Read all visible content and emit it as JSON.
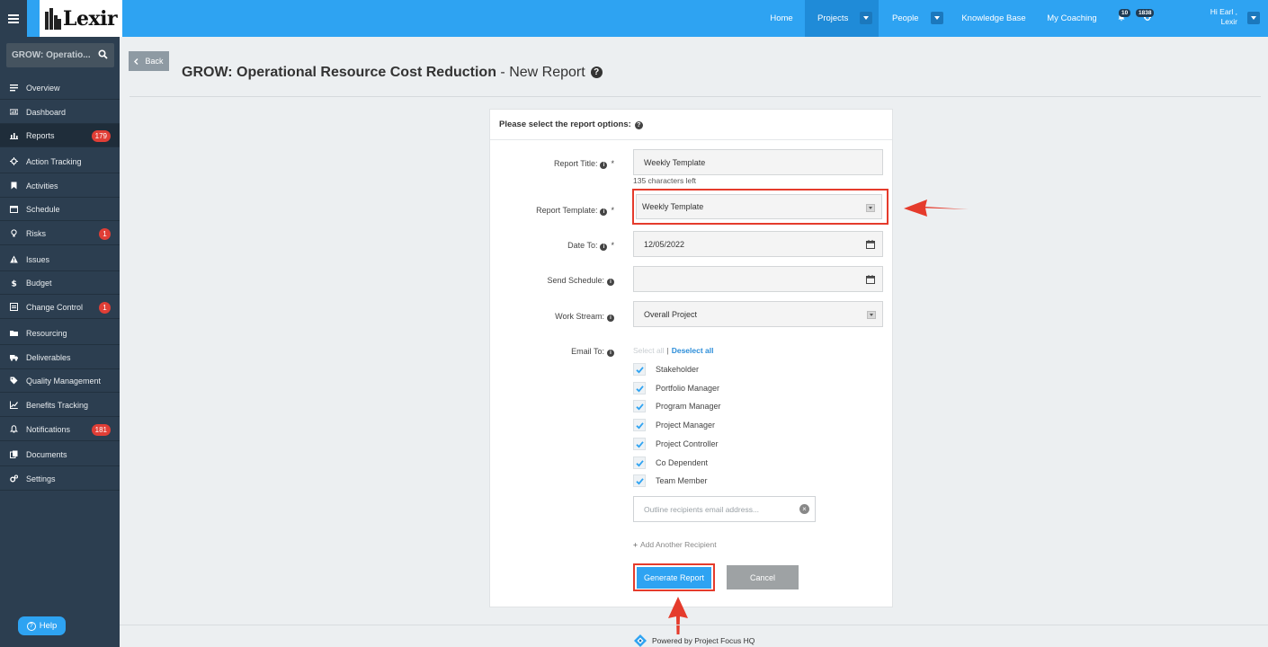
{
  "app": {
    "logo_text": "Lexir"
  },
  "nav": {
    "home": "Home",
    "projects": "Projects",
    "people": "People",
    "knowledge_base": "Knowledge Base",
    "my_coaching": "My Coaching",
    "alerts_count": "10",
    "sync_count": "1838",
    "user_greeting": "Hi Earl ,",
    "user_org": "Lexir"
  },
  "sidebar": {
    "project_search": "GROW: Operatio...",
    "items": [
      {
        "label": "Overview",
        "icon": "list-icon"
      },
      {
        "label": "Dashboard",
        "icon": "dashboard-icon"
      },
      {
        "label": "Reports",
        "icon": "bar-chart-icon",
        "badge": "179"
      },
      {
        "label": "Action Tracking",
        "icon": "crosshair-icon"
      },
      {
        "label": "Activities",
        "icon": "bookmark-icon"
      },
      {
        "label": "Schedule",
        "icon": "calendar-icon"
      },
      {
        "label": "Risks",
        "icon": "lightbulb-icon",
        "badge": "1"
      },
      {
        "label": "Issues",
        "icon": "warning-icon"
      },
      {
        "label": "Budget",
        "icon": "dollar-icon"
      },
      {
        "label": "Change Control",
        "icon": "change-control-icon",
        "badge": "1"
      },
      {
        "label": "Resourcing",
        "icon": "folder-icon"
      },
      {
        "label": "Deliverables",
        "icon": "truck-icon"
      },
      {
        "label": "Quality Management",
        "icon": "tag-icon"
      },
      {
        "label": "Benefits Tracking",
        "icon": "line-chart-icon"
      },
      {
        "label": "Notifications",
        "icon": "bell-icon",
        "badge": "181"
      },
      {
        "label": "Documents",
        "icon": "documents-icon"
      },
      {
        "label": "Settings",
        "icon": "gears-icon"
      }
    ],
    "help": "Help"
  },
  "page": {
    "back": "Back",
    "title_bold": "GROW: Operational Resource Cost Reduction",
    "title_rest": " - New Report"
  },
  "form": {
    "heading": "Please select the report options:",
    "report_title_label": "Report Title:",
    "report_title_value": "Weekly Template",
    "chars_left": "135 characters left",
    "template_label": "Report Template:",
    "template_value": "Weekly Template",
    "date_to_label": "Date To:",
    "date_to_value": "12/05/2022",
    "send_schedule_label": "Send Schedule:",
    "send_schedule_value": "",
    "work_stream_label": "Work Stream:",
    "work_stream_value": "Overall Project",
    "email_to_label": "Email To:",
    "select_all": "Select all",
    "separator": "|",
    "deselect_all": "Deselect all",
    "recipients": [
      {
        "label": "Stakeholder",
        "checked": true
      },
      {
        "label": "Portfolio Manager",
        "checked": true
      },
      {
        "label": "Program Manager",
        "checked": true
      },
      {
        "label": "Project Manager",
        "checked": true
      },
      {
        "label": "Project Controller",
        "checked": true
      },
      {
        "label": "Co Dependent",
        "checked": true
      },
      {
        "label": "Team Member",
        "checked": true
      }
    ],
    "email_placeholder": "Outline recipients email address...",
    "add_recipient": "Add Another Recipient",
    "generate": "Generate Report",
    "cancel": "Cancel",
    "required_mark": "*"
  },
  "footer": {
    "powered_by": "Powered by Project Focus HQ"
  },
  "colors": {
    "accent": "#2ea3f2",
    "sidebar": "#2c3e50",
    "highlight": "#e53b2c",
    "badge": "#e03e36"
  }
}
